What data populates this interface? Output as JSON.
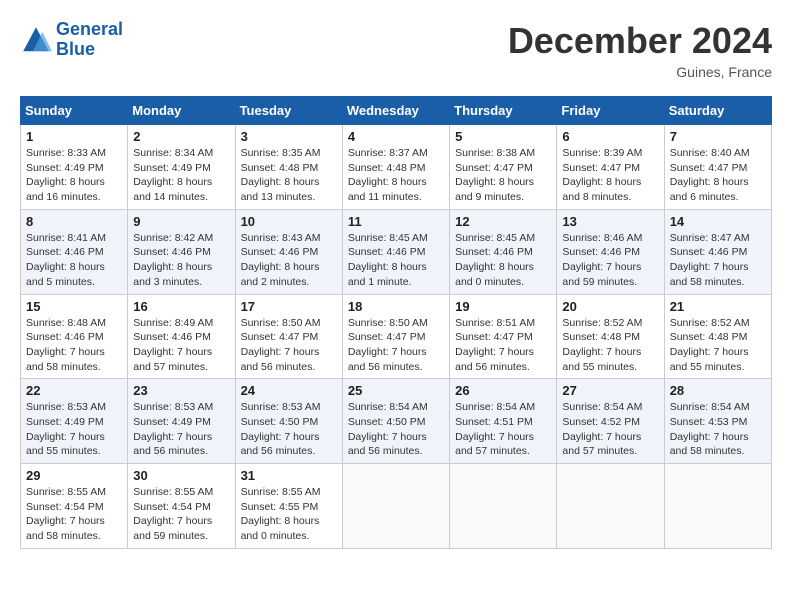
{
  "header": {
    "logo_line1": "General",
    "logo_line2": "Blue",
    "month": "December 2024",
    "location": "Guines, France"
  },
  "weekdays": [
    "Sunday",
    "Monday",
    "Tuesday",
    "Wednesday",
    "Thursday",
    "Friday",
    "Saturday"
  ],
  "weeks": [
    [
      {
        "day": "1",
        "info": "Sunrise: 8:33 AM\nSunset: 4:49 PM\nDaylight: 8 hours\nand 16 minutes."
      },
      {
        "day": "2",
        "info": "Sunrise: 8:34 AM\nSunset: 4:49 PM\nDaylight: 8 hours\nand 14 minutes."
      },
      {
        "day": "3",
        "info": "Sunrise: 8:35 AM\nSunset: 4:48 PM\nDaylight: 8 hours\nand 13 minutes."
      },
      {
        "day": "4",
        "info": "Sunrise: 8:37 AM\nSunset: 4:48 PM\nDaylight: 8 hours\nand 11 minutes."
      },
      {
        "day": "5",
        "info": "Sunrise: 8:38 AM\nSunset: 4:47 PM\nDaylight: 8 hours\nand 9 minutes."
      },
      {
        "day": "6",
        "info": "Sunrise: 8:39 AM\nSunset: 4:47 PM\nDaylight: 8 hours\nand 8 minutes."
      },
      {
        "day": "7",
        "info": "Sunrise: 8:40 AM\nSunset: 4:47 PM\nDaylight: 8 hours\nand 6 minutes."
      }
    ],
    [
      {
        "day": "8",
        "info": "Sunrise: 8:41 AM\nSunset: 4:46 PM\nDaylight: 8 hours\nand 5 minutes."
      },
      {
        "day": "9",
        "info": "Sunrise: 8:42 AM\nSunset: 4:46 PM\nDaylight: 8 hours\nand 3 minutes."
      },
      {
        "day": "10",
        "info": "Sunrise: 8:43 AM\nSunset: 4:46 PM\nDaylight: 8 hours\nand 2 minutes."
      },
      {
        "day": "11",
        "info": "Sunrise: 8:45 AM\nSunset: 4:46 PM\nDaylight: 8 hours\nand 1 minute."
      },
      {
        "day": "12",
        "info": "Sunrise: 8:45 AM\nSunset: 4:46 PM\nDaylight: 8 hours\nand 0 minutes."
      },
      {
        "day": "13",
        "info": "Sunrise: 8:46 AM\nSunset: 4:46 PM\nDaylight: 7 hours\nand 59 minutes."
      },
      {
        "day": "14",
        "info": "Sunrise: 8:47 AM\nSunset: 4:46 PM\nDaylight: 7 hours\nand 58 minutes."
      }
    ],
    [
      {
        "day": "15",
        "info": "Sunrise: 8:48 AM\nSunset: 4:46 PM\nDaylight: 7 hours\nand 58 minutes."
      },
      {
        "day": "16",
        "info": "Sunrise: 8:49 AM\nSunset: 4:46 PM\nDaylight: 7 hours\nand 57 minutes."
      },
      {
        "day": "17",
        "info": "Sunrise: 8:50 AM\nSunset: 4:47 PM\nDaylight: 7 hours\nand 56 minutes."
      },
      {
        "day": "18",
        "info": "Sunrise: 8:50 AM\nSunset: 4:47 PM\nDaylight: 7 hours\nand 56 minutes."
      },
      {
        "day": "19",
        "info": "Sunrise: 8:51 AM\nSunset: 4:47 PM\nDaylight: 7 hours\nand 56 minutes."
      },
      {
        "day": "20",
        "info": "Sunrise: 8:52 AM\nSunset: 4:48 PM\nDaylight: 7 hours\nand 55 minutes."
      },
      {
        "day": "21",
        "info": "Sunrise: 8:52 AM\nSunset: 4:48 PM\nDaylight: 7 hours\nand 55 minutes."
      }
    ],
    [
      {
        "day": "22",
        "info": "Sunrise: 8:53 AM\nSunset: 4:49 PM\nDaylight: 7 hours\nand 55 minutes."
      },
      {
        "day": "23",
        "info": "Sunrise: 8:53 AM\nSunset: 4:49 PM\nDaylight: 7 hours\nand 56 minutes."
      },
      {
        "day": "24",
        "info": "Sunrise: 8:53 AM\nSunset: 4:50 PM\nDaylight: 7 hours\nand 56 minutes."
      },
      {
        "day": "25",
        "info": "Sunrise: 8:54 AM\nSunset: 4:50 PM\nDaylight: 7 hours\nand 56 minutes."
      },
      {
        "day": "26",
        "info": "Sunrise: 8:54 AM\nSunset: 4:51 PM\nDaylight: 7 hours\nand 57 minutes."
      },
      {
        "day": "27",
        "info": "Sunrise: 8:54 AM\nSunset: 4:52 PM\nDaylight: 7 hours\nand 57 minutes."
      },
      {
        "day": "28",
        "info": "Sunrise: 8:54 AM\nSunset: 4:53 PM\nDaylight: 7 hours\nand 58 minutes."
      }
    ],
    [
      {
        "day": "29",
        "info": "Sunrise: 8:55 AM\nSunset: 4:54 PM\nDaylight: 7 hours\nand 58 minutes."
      },
      {
        "day": "30",
        "info": "Sunrise: 8:55 AM\nSunset: 4:54 PM\nDaylight: 7 hours\nand 59 minutes."
      },
      {
        "day": "31",
        "info": "Sunrise: 8:55 AM\nSunset: 4:55 PM\nDaylight: 8 hours\nand 0 minutes."
      },
      {
        "day": "",
        "info": ""
      },
      {
        "day": "",
        "info": ""
      },
      {
        "day": "",
        "info": ""
      },
      {
        "day": "",
        "info": ""
      }
    ]
  ]
}
